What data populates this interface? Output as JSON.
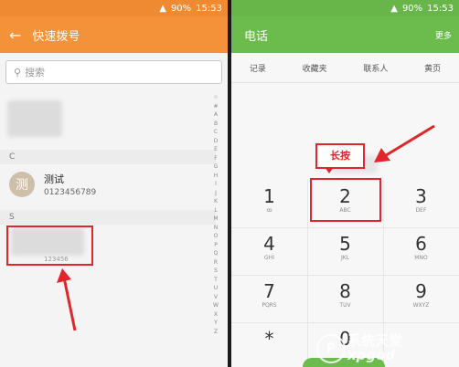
{
  "status": {
    "left_time": "15:53",
    "right_time": "15:53",
    "battery": "90%"
  },
  "left": {
    "title": "快速拨号",
    "search_placeholder": "搜索",
    "section_c": "C",
    "section_s": "S",
    "contact": {
      "avatar_char": "测",
      "name": "测试",
      "number": "0123456789"
    },
    "index": [
      "☆",
      "#",
      "A",
      "B",
      "C",
      "D",
      "E",
      "F",
      "G",
      "H",
      "I",
      "J",
      "K",
      "L",
      "M",
      "N",
      "O",
      "P",
      "Q",
      "R",
      "S",
      "T",
      "U",
      "V",
      "W",
      "X",
      "Y",
      "Z"
    ],
    "partial_number": "123456"
  },
  "right": {
    "title": "电话",
    "more": "更多",
    "tabs": [
      "记录",
      "收藏夹",
      "联系人",
      "黄页"
    ],
    "callout": "长按",
    "keys": [
      {
        "d": "1",
        "l": "ꝏ"
      },
      {
        "d": "2",
        "l": "ABC"
      },
      {
        "d": "3",
        "l": "DEF"
      },
      {
        "d": "4",
        "l": "GHI"
      },
      {
        "d": "5",
        "l": "JKL"
      },
      {
        "d": "6",
        "l": "MNO"
      },
      {
        "d": "7",
        "l": "PQRS"
      },
      {
        "d": "8",
        "l": "TUV"
      },
      {
        "d": "9",
        "l": "WXYZ"
      },
      {
        "d": "*",
        "l": ""
      },
      {
        "d": "0",
        "l": ""
      },
      {
        "d": "",
        "l": ""
      }
    ]
  },
  "watermark": {
    "logo": "P",
    "text": "系统天堂",
    "sub": "xpgod"
  },
  "colors": {
    "orange": "#f39238",
    "green": "#6cbb4d",
    "red": "#e0262a"
  }
}
